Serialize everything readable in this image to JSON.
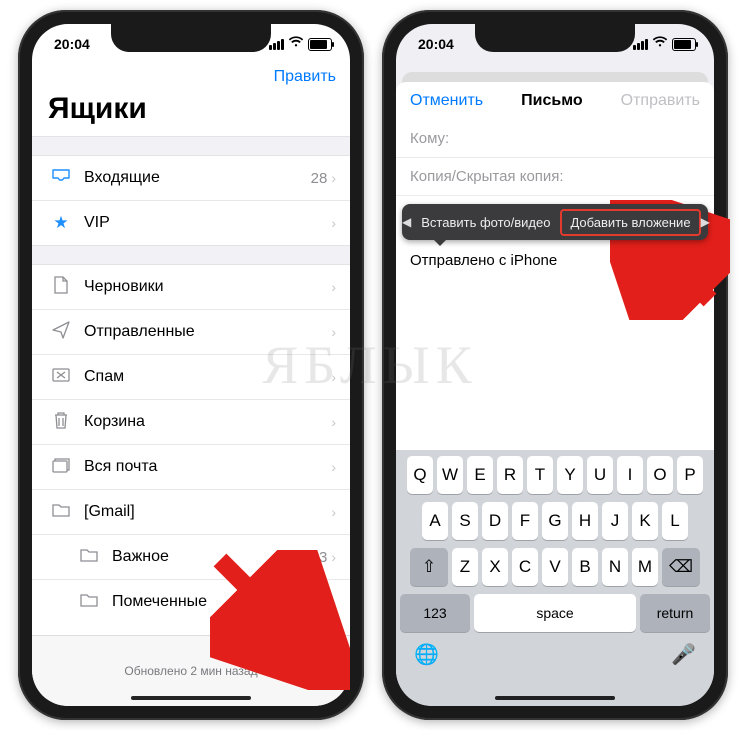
{
  "status": {
    "time": "20:04"
  },
  "left": {
    "edit": "Править",
    "title": "Ящики",
    "rows": [
      {
        "icon": "tray-icon",
        "glyph": "📥",
        "label": "Входящие",
        "count": "28"
      },
      {
        "icon": "star-icon",
        "glyph": "★",
        "label": "VIP",
        "count": ""
      }
    ],
    "rows2": [
      {
        "icon": "doc-icon",
        "glyph": "🗎",
        "label": "Черновики"
      },
      {
        "icon": "send-icon",
        "glyph": "➤",
        "label": "Отправленные"
      },
      {
        "icon": "spam-icon",
        "glyph": "⌧",
        "label": "Спам"
      },
      {
        "icon": "trash-icon",
        "glyph": "🗑",
        "label": "Корзина"
      },
      {
        "icon": "allmail-icon",
        "glyph": "🗃",
        "label": "Вся почта"
      },
      {
        "icon": "folder-icon",
        "glyph": "🗀",
        "label": "[Gmail]"
      }
    ],
    "subrows": [
      {
        "icon": "folder-icon",
        "glyph": "🗀",
        "label": "Важное",
        "count": "3"
      },
      {
        "icon": "folder-icon",
        "glyph": "🗀",
        "label": "Помеченные",
        "count": ""
      }
    ],
    "updated": "Обновлено 2 мин назад"
  },
  "right": {
    "cancel": "Отменить",
    "title": "Письмо",
    "send": "Отправить",
    "to": "Кому:",
    "cc": "Копия/Скрытая копия:",
    "menu": {
      "opt1": "Вставить фото/видео",
      "opt2": "Добавить вложение"
    },
    "signature": "Отправлено с iPhone",
    "keyboard": {
      "r1": [
        "Q",
        "W",
        "E",
        "R",
        "T",
        "Y",
        "U",
        "I",
        "O",
        "P"
      ],
      "r2": [
        "A",
        "S",
        "D",
        "F",
        "G",
        "H",
        "J",
        "K",
        "L"
      ],
      "r3": [
        "Z",
        "X",
        "C",
        "V",
        "B",
        "N",
        "M"
      ],
      "shift": "⇧",
      "bksp": "⌫",
      "num": "123",
      "space": "space",
      "ret": "return",
      "globe": "🌐",
      "mic": "🎤"
    }
  },
  "watermark": "ЯБЛЫК"
}
